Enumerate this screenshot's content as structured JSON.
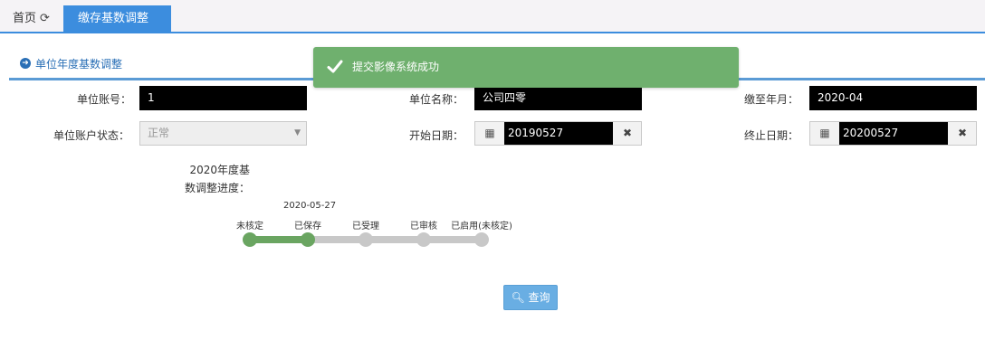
{
  "tabs": {
    "home_label": "首页",
    "active_label": "缴存基数调整"
  },
  "section": {
    "title": "单位年度基数调整"
  },
  "form": {
    "account_label": "单位账号：",
    "account_value": "1",
    "name_label": "单位名称：",
    "name_value": "公司四零",
    "paid_until_label": "缴至年月：",
    "paid_until_value": "2020-04",
    "status_label": "单位账户状态：",
    "status_value": "正常",
    "start_label": "开始日期：",
    "start_value": "20190527",
    "end_label": "终止日期：",
    "end_value": "20200527"
  },
  "progress": {
    "label_line1": "2020年度基",
    "label_line2": "数调整进度：",
    "date": "2020-05-27",
    "current_step_index": 1,
    "steps": [
      "未核定",
      "已保存",
      "已受理",
      "已审核",
      "已启用(未核定)"
    ]
  },
  "query_button": {
    "label": "查询"
  },
  "toast": {
    "message": "提交影像系统成功",
    "color": "#6fb06e"
  },
  "colors": {
    "accent": "#3c8dde",
    "done": "#6aa561",
    "pending": "#c8c8c8"
  }
}
